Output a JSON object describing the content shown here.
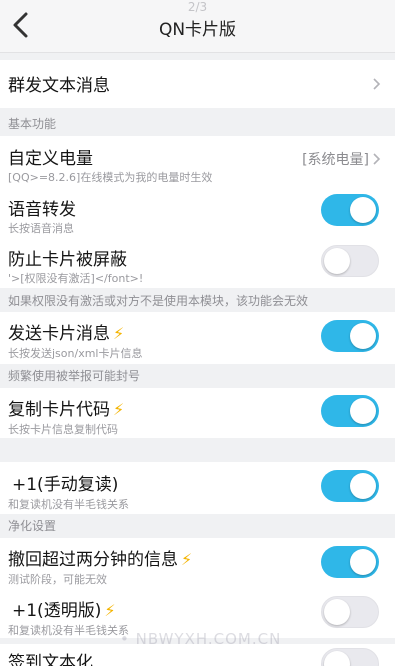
{
  "header": {
    "pager": "2/3",
    "title": "QN卡片版"
  },
  "top_item": {
    "label": "群发文本消息"
  },
  "section_basic": "基本功能",
  "battery": {
    "label": "自定义电量",
    "sub": "[QQ>=8.2.6]在线模式为我的电量时生效",
    "value": "[系统电量]"
  },
  "voice": {
    "label": "语音转发",
    "sub": "长按语音消息",
    "enabled": true
  },
  "card_block": {
    "label": "防止卡片被屏蔽",
    "sub": "'>[权限没有激活]</font>!",
    "enabled": false
  },
  "card_block_note": "如果权限没有激活或对方不是使用本模块，该功能会无效",
  "send_card": {
    "label": "发送卡片消息",
    "sub": "长按发送json/xml卡片信息",
    "enabled": true
  },
  "send_card_note": "频繁使用被举报可能封号",
  "copy_card": {
    "label": "复制卡片代码",
    "sub": "长按卡片信息复制代码",
    "enabled": true
  },
  "plus_one": {
    "label": "+1(手动复读)",
    "sub": "和复读机没有半毛钱关系",
    "enabled": true
  },
  "section_purify": "净化设置",
  "recall": {
    "label": "撤回超过两分钟的信息",
    "sub": "测试阶段，可能无效",
    "enabled": true
  },
  "plus_one_clear": {
    "label": "+1(透明版)",
    "sub": "和复读机没有半毛钱关系",
    "enabled": false
  },
  "sign_in": {
    "label": "签到文本化"
  },
  "watermark": "• NBWYXH.COM.CN",
  "colors": {
    "toggle_on": "#2fb7e8",
    "toggle_off": "#e9e9ee",
    "bolt": "#f4b400"
  },
  "icons": {
    "bolt": "⚡"
  }
}
